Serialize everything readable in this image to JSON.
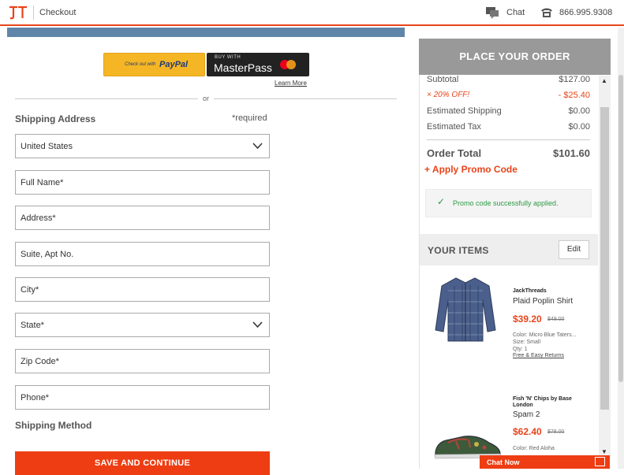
{
  "header": {
    "logo": "JT",
    "checkout_label": "Checkout",
    "chat_label": "Chat",
    "phone": "866.995.9308"
  },
  "express": {
    "paypal_small": "Check out with",
    "paypal_big": "PayPal",
    "masterpass_small": "BUY WITH",
    "masterpass_big": "MasterPass",
    "learn_more": "Learn More",
    "or": "or"
  },
  "form": {
    "shipping_title": "Shipping Address",
    "required_note": "*required",
    "country": "United States",
    "full_name": "Full Name*",
    "address": "Address*",
    "suite": "Suite, Apt No.",
    "city": "City*",
    "state": "State*",
    "zip": "Zip Code*",
    "phone": "Phone*",
    "shipping_method_title": "Shipping Method",
    "save_button": "SAVE AND CONTINUE"
  },
  "summary": {
    "place_order": "PLACE YOUR ORDER",
    "subtotal_label": "Subtotal",
    "subtotal_value": "$127.00",
    "discount_label": "× 20% OFF!",
    "discount_value": "- $25.40",
    "shipping_label": "Estimated Shipping",
    "shipping_value": "$0.00",
    "tax_label": "Estimated Tax",
    "tax_value": "$0.00",
    "total_label": "Order Total",
    "total_value": "$101.60",
    "promo_link": "+ Apply Promo Code",
    "promo_success": "Promo code successfully applied.",
    "items_title": "YOUR ITEMS",
    "edit_button": "Edit"
  },
  "items": [
    {
      "brand": "JackThreads",
      "name": "Plaid Poplin Shirt",
      "price": "$39.20",
      "original_price": "$49.00",
      "color": "Color: Micro Blue Taters...",
      "size": "Size: Small",
      "qty": "Qty: 1",
      "link": "Free & Easy Returns"
    },
    {
      "brand": "Fish 'N' Chips by Base London",
      "name": "Spam 2",
      "price": "$62.40",
      "original_price": "$78.00",
      "color": "Color: Red Aloha"
    }
  ],
  "chat_widget": {
    "label": "Chat Now"
  },
  "colors": {
    "accent": "#ee3d12",
    "header_strip": "#5f86a8",
    "place_order_bg": "#999999",
    "success": "#2e9a44"
  },
  "icons": [
    "jt-logo-icon",
    "chat-icon",
    "phone-icon",
    "chevron-down-icon",
    "checkmark-icon",
    "chat-window-icon"
  ]
}
